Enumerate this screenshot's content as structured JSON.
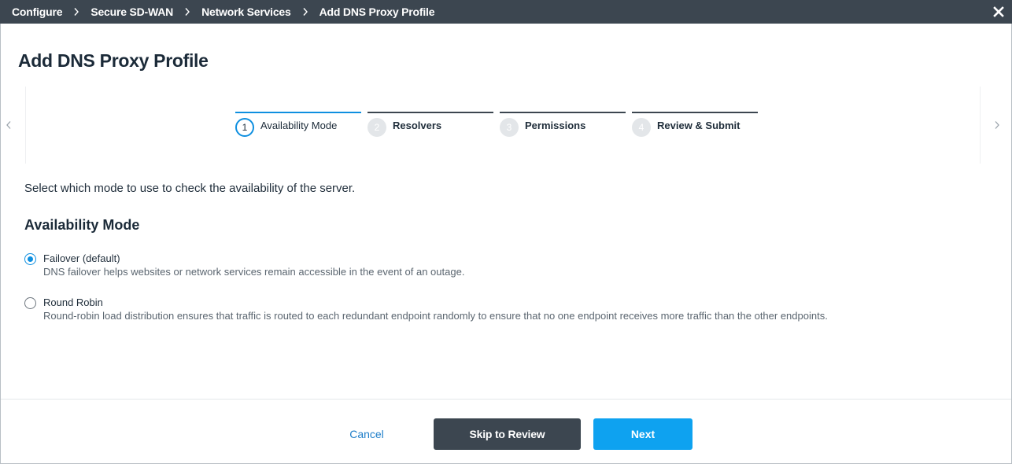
{
  "breadcrumb": {
    "items": [
      "Configure",
      "Secure SD-WAN",
      "Network Services",
      "Add DNS Proxy Profile"
    ]
  },
  "close_icon": "close-icon",
  "page_title": "Add DNS Proxy Profile",
  "stepper": {
    "steps": [
      {
        "number": "1",
        "label": "Availability Mode",
        "state": "active"
      },
      {
        "number": "2",
        "label": "Resolvers",
        "state": "inactive"
      },
      {
        "number": "3",
        "label": "Permissions",
        "state": "inactive"
      },
      {
        "number": "4",
        "label": "Review & Submit",
        "state": "inactive"
      }
    ],
    "prev_icon": "chevron-left-icon",
    "next_icon": "chevron-right-icon"
  },
  "main": {
    "instruction": "Select which mode to use to check the availability of the server.",
    "section_title": "Availability Mode",
    "options": [
      {
        "label": "Failover (default)",
        "description": "DNS failover helps websites or network services remain accessible in the event of an outage.",
        "selected": true
      },
      {
        "label": "Round Robin",
        "description": "Round-robin load distribution ensures that traffic is routed to each redundant endpoint randomly to ensure that no one endpoint receives more traffic than the other endpoints.",
        "selected": false
      }
    ]
  },
  "footer": {
    "cancel_label": "Cancel",
    "skip_label": "Skip to Review",
    "next_label": "Next"
  },
  "colors": {
    "topbar": "#3c4650",
    "accent": "#0e8fe0",
    "primary_button": "#0ea2f0",
    "secondary_button": "#3c4650",
    "link": "#1f7ec9"
  }
}
